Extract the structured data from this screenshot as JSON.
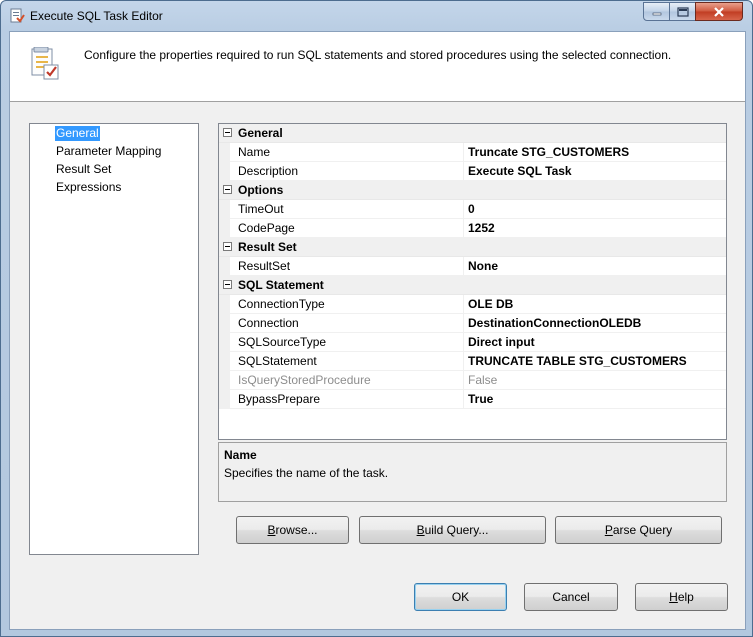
{
  "window": {
    "title": "Execute SQL Task Editor"
  },
  "header": {
    "text": "Configure the properties required to run SQL statements and stored procedures using the selected connection."
  },
  "nav": {
    "items": [
      {
        "label": "General",
        "selected": true
      },
      {
        "label": "Parameter Mapping",
        "selected": false
      },
      {
        "label": "Result Set",
        "selected": false
      },
      {
        "label": "Expressions",
        "selected": false
      }
    ]
  },
  "grid": {
    "categories": [
      {
        "label": "General",
        "props": [
          {
            "name": "Name",
            "value": "Truncate STG_CUSTOMERS"
          },
          {
            "name": "Description",
            "value": "Execute SQL Task"
          }
        ]
      },
      {
        "label": "Options",
        "props": [
          {
            "name": "TimeOut",
            "value": "0"
          },
          {
            "name": "CodePage",
            "value": "1252"
          }
        ]
      },
      {
        "label": "Result Set",
        "props": [
          {
            "name": "ResultSet",
            "value": "None"
          }
        ]
      },
      {
        "label": "SQL Statement",
        "props": [
          {
            "name": "ConnectionType",
            "value": "OLE DB"
          },
          {
            "name": "Connection",
            "value": "DestinationConnectionOLEDB"
          },
          {
            "name": "SQLSourceType",
            "value": "Direct input"
          },
          {
            "name": "SQLStatement",
            "value": "TRUNCATE TABLE STG_CUSTOMERS"
          },
          {
            "name": "IsQueryStoredProcedure",
            "value": "False",
            "disabled": true
          },
          {
            "name": "BypassPrepare",
            "value": "True"
          }
        ]
      }
    ]
  },
  "description": {
    "title": "Name",
    "text": "Specifies the name of the task."
  },
  "buttons": {
    "browse": {
      "pre": "",
      "mn": "B",
      "post": "rowse..."
    },
    "build_query": {
      "pre": "",
      "mn": "B",
      "post": "uild Query..."
    },
    "parse_query": {
      "pre": "",
      "mn": "P",
      "post": "arse Query"
    },
    "ok": {
      "label": "OK"
    },
    "cancel": {
      "label": "Cancel"
    },
    "help": {
      "pre": "",
      "mn": "H",
      "post": "elp"
    }
  },
  "colors": {
    "selection": "#3399ff",
    "title_bar": "#b9cde3",
    "close_button": "#c13d23"
  }
}
